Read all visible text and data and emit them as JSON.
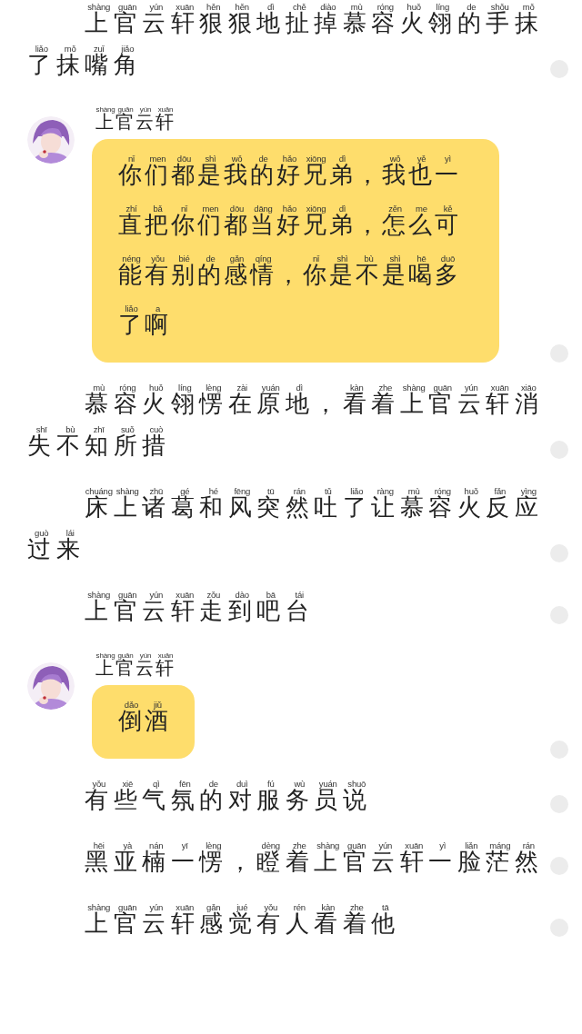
{
  "messages": [
    {
      "kind": "narration",
      "text": [
        {
          "pinyin": "shàng",
          "char": "上"
        },
        {
          "pinyin": "guān",
          "char": "官"
        },
        {
          "pinyin": "yún",
          "char": "云"
        },
        {
          "pinyin": "xuān",
          "char": "轩"
        },
        {
          "pinyin": "hěn",
          "char": "狠"
        },
        {
          "pinyin": "hěn",
          "char": "狠"
        },
        {
          "pinyin": "dì",
          "char": "地"
        },
        {
          "pinyin": "chě",
          "char": "扯"
        },
        {
          "pinyin": "diào",
          "char": "掉"
        },
        {
          "pinyin": "mù",
          "char": "慕"
        },
        {
          "pinyin": "róng",
          "char": "容"
        },
        {
          "pinyin": "huǒ",
          "char": "火"
        },
        {
          "pinyin": "líng",
          "char": "翎"
        },
        {
          "pinyin": "de",
          "char": "的"
        },
        {
          "pinyin": "shǒu",
          "char": "手"
        },
        {
          "pinyin": "mǒ",
          "char": "抹"
        },
        {
          "pinyin": "liǎo",
          "char": "了"
        },
        {
          "pinyin": "mǒ",
          "char": "抹"
        },
        {
          "pinyin": "zuǐ",
          "char": "嘴"
        },
        {
          "pinyin": "jiǎo",
          "char": "角"
        }
      ]
    },
    {
      "kind": "speech",
      "speaker": [
        {
          "pinyin": "shàng",
          "char": "上"
        },
        {
          "pinyin": "guān",
          "char": "官"
        },
        {
          "pinyin": "yún",
          "char": "云"
        },
        {
          "pinyin": "xuān",
          "char": "轩"
        }
      ],
      "text": [
        {
          "pinyin": "nǐ",
          "char": "你"
        },
        {
          "pinyin": "men",
          "char": "们"
        },
        {
          "pinyin": "dōu",
          "char": "都"
        },
        {
          "pinyin": "shì",
          "char": "是"
        },
        {
          "pinyin": "wǒ",
          "char": "我"
        },
        {
          "pinyin": "de",
          "char": "的"
        },
        {
          "pinyin": "hǎo",
          "char": "好"
        },
        {
          "pinyin": "xiōng",
          "char": "兄"
        },
        {
          "pinyin": "dì",
          "char": "弟"
        },
        {
          "char": "，"
        },
        {
          "pinyin": "wǒ",
          "char": "我"
        },
        {
          "pinyin": "yě",
          "char": "也"
        },
        {
          "pinyin": "yì",
          "char": "一"
        },
        {
          "pinyin": "zhí",
          "char": "直"
        },
        {
          "pinyin": "bǎ",
          "char": "把"
        },
        {
          "pinyin": "nǐ",
          "char": "你"
        },
        {
          "pinyin": "men",
          "char": "们"
        },
        {
          "pinyin": "dōu",
          "char": "都"
        },
        {
          "pinyin": "dāng",
          "char": "当"
        },
        {
          "pinyin": "hǎo",
          "char": "好"
        },
        {
          "pinyin": "xiōng",
          "char": "兄"
        },
        {
          "pinyin": "dì",
          "char": "弟"
        },
        {
          "char": "，"
        },
        {
          "pinyin": "zěn",
          "char": "怎"
        },
        {
          "pinyin": "me",
          "char": "么"
        },
        {
          "pinyin": "kě",
          "char": "可"
        },
        {
          "pinyin": "néng",
          "char": "能"
        },
        {
          "pinyin": "yǒu",
          "char": "有"
        },
        {
          "pinyin": "bié",
          "char": "别"
        },
        {
          "pinyin": "de",
          "char": "的"
        },
        {
          "pinyin": "gǎn",
          "char": "感"
        },
        {
          "pinyin": "qíng",
          "char": "情"
        },
        {
          "char": "，"
        },
        {
          "pinyin": "nǐ",
          "char": "你"
        },
        {
          "pinyin": "shì",
          "char": "是"
        },
        {
          "pinyin": "bù",
          "char": "不"
        },
        {
          "pinyin": "shì",
          "char": "是"
        },
        {
          "pinyin": "hē",
          "char": "喝"
        },
        {
          "pinyin": "duō",
          "char": "多"
        },
        {
          "pinyin": "liǎo",
          "char": "了"
        },
        {
          "pinyin": "a",
          "char": "啊"
        }
      ]
    },
    {
      "kind": "narration",
      "text": [
        {
          "pinyin": "mù",
          "char": "慕"
        },
        {
          "pinyin": "róng",
          "char": "容"
        },
        {
          "pinyin": "huǒ",
          "char": "火"
        },
        {
          "pinyin": "líng",
          "char": "翎"
        },
        {
          "pinyin": "lèng",
          "char": "愣"
        },
        {
          "pinyin": "zài",
          "char": "在"
        },
        {
          "pinyin": "yuán",
          "char": "原"
        },
        {
          "pinyin": "dì",
          "char": "地"
        },
        {
          "char": "，"
        },
        {
          "pinyin": "kàn",
          "char": "看"
        },
        {
          "pinyin": "zhe",
          "char": "着"
        },
        {
          "pinyin": "shàng",
          "char": "上"
        },
        {
          "pinyin": "guān",
          "char": "官"
        },
        {
          "pinyin": "yún",
          "char": "云"
        },
        {
          "pinyin": "xuān",
          "char": "轩"
        },
        {
          "pinyin": "xiāo",
          "char": "消"
        },
        {
          "pinyin": "shī",
          "char": "失"
        },
        {
          "pinyin": "bù",
          "char": "不"
        },
        {
          "pinyin": "zhī",
          "char": "知"
        },
        {
          "pinyin": "suǒ",
          "char": "所"
        },
        {
          "pinyin": "cuò",
          "char": "措"
        }
      ]
    },
    {
      "kind": "narration",
      "text": [
        {
          "pinyin": "chuáng",
          "char": "床"
        },
        {
          "pinyin": "shàng",
          "char": "上"
        },
        {
          "pinyin": "zhū",
          "char": "诸"
        },
        {
          "pinyin": "gé",
          "char": "葛"
        },
        {
          "pinyin": "hé",
          "char": "和"
        },
        {
          "pinyin": "fēng",
          "char": "风"
        },
        {
          "pinyin": "tū",
          "char": "突"
        },
        {
          "pinyin": "rán",
          "char": "然"
        },
        {
          "pinyin": "tǔ",
          "char": "吐"
        },
        {
          "pinyin": "liǎo",
          "char": "了"
        },
        {
          "pinyin": "ràng",
          "char": "让"
        },
        {
          "pinyin": "mù",
          "char": "慕"
        },
        {
          "pinyin": "róng",
          "char": "容"
        },
        {
          "pinyin": "huǒ",
          "char": "火"
        },
        {
          "pinyin": "fǎn",
          "char": "反"
        },
        {
          "pinyin": "yìng",
          "char": "应"
        },
        {
          "pinyin": "guò",
          "char": "过"
        },
        {
          "pinyin": "lái",
          "char": "来"
        }
      ]
    },
    {
      "kind": "narration",
      "text": [
        {
          "pinyin": "shàng",
          "char": "上"
        },
        {
          "pinyin": "guān",
          "char": "官"
        },
        {
          "pinyin": "yún",
          "char": "云"
        },
        {
          "pinyin": "xuān",
          "char": "轩"
        },
        {
          "pinyin": "zǒu",
          "char": "走"
        },
        {
          "pinyin": "dào",
          "char": "到"
        },
        {
          "pinyin": "bā",
          "char": "吧"
        },
        {
          "pinyin": "tái",
          "char": "台"
        }
      ]
    },
    {
      "kind": "speech",
      "speaker": [
        {
          "pinyin": "shàng",
          "char": "上"
        },
        {
          "pinyin": "guān",
          "char": "官"
        },
        {
          "pinyin": "yún",
          "char": "云"
        },
        {
          "pinyin": "xuān",
          "char": "轩"
        }
      ],
      "text": [
        {
          "pinyin": "dǎo",
          "char": "倒"
        },
        {
          "pinyin": "jiǔ",
          "char": "酒"
        }
      ]
    },
    {
      "kind": "narration",
      "text": [
        {
          "pinyin": "yǒu",
          "char": "有"
        },
        {
          "pinyin": "xiē",
          "char": "些"
        },
        {
          "pinyin": "qì",
          "char": "气"
        },
        {
          "pinyin": "fēn",
          "char": "氛"
        },
        {
          "pinyin": "de",
          "char": "的"
        },
        {
          "pinyin": "duì",
          "char": "对"
        },
        {
          "pinyin": "fú",
          "char": "服"
        },
        {
          "pinyin": "wù",
          "char": "务"
        },
        {
          "pinyin": "yuán",
          "char": "员"
        },
        {
          "pinyin": "shuō",
          "char": "说"
        }
      ]
    },
    {
      "kind": "narration",
      "text": [
        {
          "pinyin": "hēi",
          "char": "黑"
        },
        {
          "pinyin": "yà",
          "char": "亚"
        },
        {
          "pinyin": "nán",
          "char": "楠"
        },
        {
          "pinyin": "yī",
          "char": "一"
        },
        {
          "pinyin": "lèng",
          "char": "愣"
        },
        {
          "char": "，"
        },
        {
          "pinyin": "dèng",
          "char": "瞪"
        },
        {
          "pinyin": "zhe",
          "char": "着"
        },
        {
          "pinyin": "shàng",
          "char": "上"
        },
        {
          "pinyin": "guān",
          "char": "官"
        },
        {
          "pinyin": "yún",
          "char": "云"
        },
        {
          "pinyin": "xuān",
          "char": "轩"
        },
        {
          "pinyin": "yì",
          "char": "一"
        },
        {
          "pinyin": "liǎn",
          "char": "脸"
        },
        {
          "pinyin": "máng",
          "char": "茫"
        },
        {
          "pinyin": "rán",
          "char": "然"
        }
      ]
    },
    {
      "kind": "narration",
      "text": [
        {
          "pinyin": "shàng",
          "char": "上"
        },
        {
          "pinyin": "guān",
          "char": "官"
        },
        {
          "pinyin": "yún",
          "char": "云"
        },
        {
          "pinyin": "xuān",
          "char": "轩"
        },
        {
          "pinyin": "gǎn",
          "char": "感"
        },
        {
          "pinyin": "jué",
          "char": "觉"
        },
        {
          "pinyin": "yǒu",
          "char": "有"
        },
        {
          "pinyin": "rén",
          "char": "人"
        },
        {
          "pinyin": "kàn",
          "char": "看"
        },
        {
          "pinyin": "zhe",
          "char": "着"
        },
        {
          "pinyin": "tā",
          "char": "他"
        }
      ]
    }
  ]
}
